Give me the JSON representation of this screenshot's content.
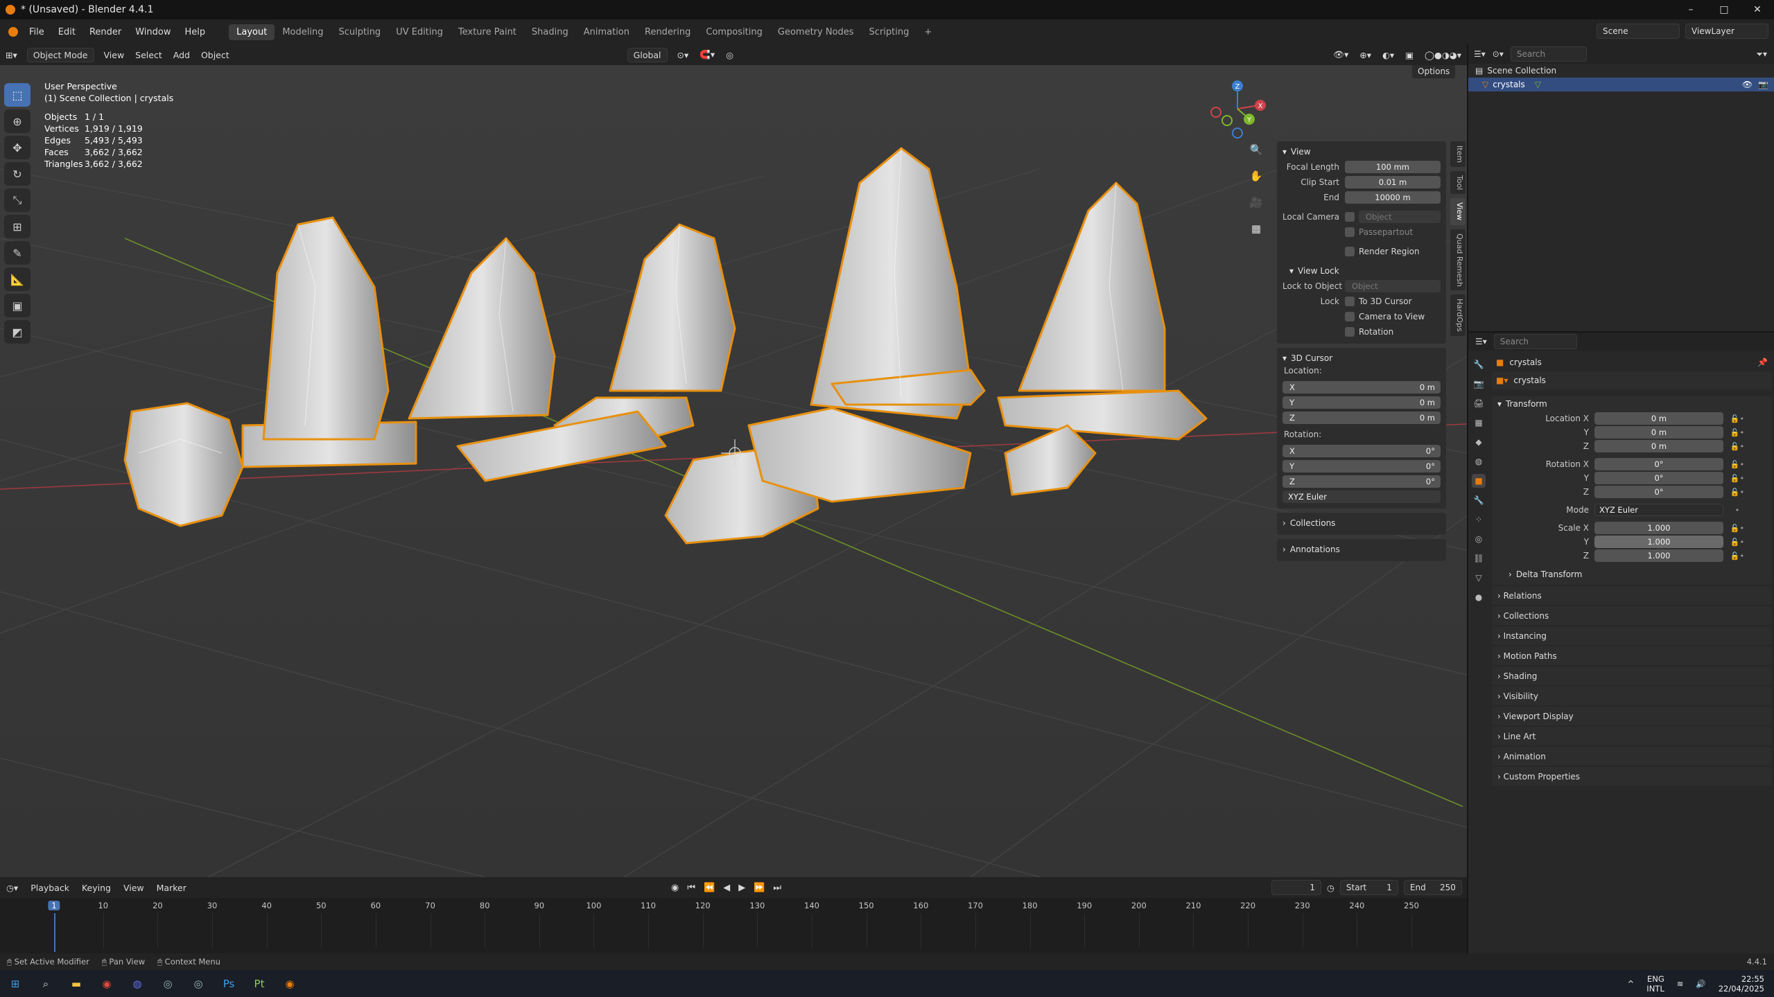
{
  "window": {
    "title": "* (Unsaved) - Blender 4.4.1",
    "min": "–",
    "max": "□",
    "close": "✕"
  },
  "menubar": {
    "menus": [
      "File",
      "Edit",
      "Render",
      "Window",
      "Help"
    ],
    "workspaces": [
      "Layout",
      "Modeling",
      "Sculpting",
      "UV Editing",
      "Texture Paint",
      "Shading",
      "Animation",
      "Rendering",
      "Compositing",
      "Geometry Nodes",
      "Scripting"
    ],
    "add_tab": "+",
    "scene": "Scene",
    "view_layer": "ViewLayer"
  },
  "viewport_header": {
    "mode": "Object Mode",
    "menus": [
      "View",
      "Select",
      "Add",
      "Object"
    ],
    "transform_orientation": "Global",
    "options": "Options"
  },
  "viewport_overlay": {
    "view_name": "User Perspective",
    "collection": "(1) Scene Collection | crystals",
    "stats": [
      {
        "label": "Objects",
        "value": "1 / 1"
      },
      {
        "label": "Vertices",
        "value": "1,919 / 1,919"
      },
      {
        "label": "Edges",
        "value": "5,493 / 5,493"
      },
      {
        "label": "Faces",
        "value": "3,662 / 3,662"
      },
      {
        "label": "Triangles",
        "value": "3,662 / 3,662"
      }
    ],
    "gizmo": {
      "x": "X",
      "y": "Y",
      "z": "Z"
    }
  },
  "colors": {
    "selection": "#e8900f",
    "active_blue": "#4772b3",
    "x_axis": "#d0424a",
    "y_axis": "#7eb82a",
    "z_axis": "#3b7fd1"
  },
  "npanel": {
    "tabs": [
      "Item",
      "Tool",
      "View",
      "Quad Remesh",
      "HardOps"
    ],
    "active_tab": "View",
    "view": {
      "title": "View",
      "focal_length_label": "Focal Length",
      "focal_length": "100 mm",
      "clip_start_label": "Clip Start",
      "clip_start": "0.01 m",
      "end_label": "End",
      "clip_end": "10000 m",
      "local_camera_label": "Local Camera",
      "local_camera_placeholder": "Object",
      "passepartout": "Passepartout",
      "render_region": "Render Region"
    },
    "view_lock": {
      "title": "View Lock",
      "lock_to_object_label": "Lock to Object",
      "lock_to_object_placeholder": "Object",
      "lock_label": "Lock",
      "to_3d_cursor": "To 3D Cursor",
      "camera_to_view": "Camera to View",
      "rotation": "Rotation"
    },
    "cursor": {
      "title": "3D Cursor",
      "location_label": "Location:",
      "location": [
        {
          "axis": "X",
          "value": "0 m"
        },
        {
          "axis": "Y",
          "value": "0 m"
        },
        {
          "axis": "Z",
          "value": "0 m"
        }
      ],
      "rotation_label": "Rotation:",
      "rotation": [
        {
          "axis": "X",
          "value": "0°"
        },
        {
          "axis": "Y",
          "value": "0°"
        },
        {
          "axis": "Z",
          "value": "0°"
        }
      ],
      "mode": "XYZ Euler"
    },
    "collections": "Collections",
    "annotations": "Annotations"
  },
  "timeline": {
    "menus": [
      "Playback",
      "Keying",
      "View",
      "Marker"
    ],
    "current_frame": "1",
    "start_label": "Start",
    "start": "1",
    "end_label": "End",
    "end": "250",
    "ticks": [
      "1",
      "10",
      "20",
      "30",
      "40",
      "50",
      "60",
      "70",
      "80",
      "90",
      "100",
      "110",
      "120",
      "130",
      "140",
      "150",
      "160",
      "170",
      "180",
      "190",
      "200",
      "210",
      "220",
      "230",
      "240",
      "250"
    ]
  },
  "outliner": {
    "search_placeholder": "Search",
    "root": "Scene Collection",
    "items": [
      "crystals"
    ]
  },
  "properties": {
    "search_placeholder": "Search",
    "object_name": "crystals",
    "object_datablock": "crystals",
    "transform": {
      "title": "Transform",
      "location_x_label": "Location X",
      "location_x": "0 m",
      "y_label": "Y",
      "location_y": "0 m",
      "z_label": "Z",
      "location_z": "0 m",
      "rotation_x_label": "Rotation X",
      "rotation_x": "0°",
      "rotation_y": "0°",
      "rotation_z": "0°",
      "mode_label": "Mode",
      "mode": "XYZ Euler",
      "scale_x_label": "Scale X",
      "scale_x": "1.000",
      "scale_y": "1.000",
      "scale_z": "1.000",
      "delta": "Delta Transform"
    },
    "sections": [
      "Relations",
      "Collections",
      "Instancing",
      "Motion Paths",
      "Shading",
      "Visibility",
      "Viewport Display",
      "Line Art",
      "Animation",
      "Custom Properties"
    ]
  },
  "statusbar": {
    "hints": [
      "Set Active Modifier",
      "Pan View",
      "Context Menu"
    ],
    "version": "4.4.1"
  },
  "taskbar": {
    "lang": "ENG",
    "lang2": "INTL",
    "time": "22:55",
    "date": "22/04/2025"
  }
}
